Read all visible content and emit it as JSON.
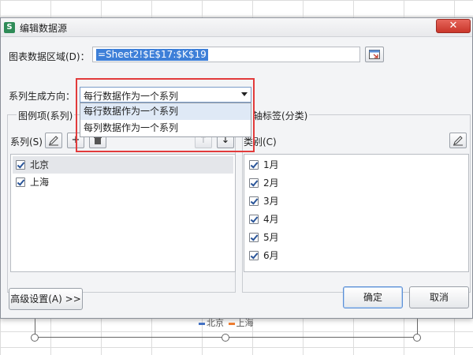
{
  "dialog": {
    "title": "编辑数据源",
    "close_label": "✕",
    "data_range_label": "图表数据区域(D)：",
    "data_range_value": "=Sheet2!$E$17:$K$19",
    "series_direction_label": "系列生成方向：",
    "series_direction_value": "每行数据作为一个系列",
    "series_direction_options": [
      "每行数据作为一个系列",
      "每列数据作为一个系列"
    ],
    "legend_group_label": "图例项(系列)",
    "series_label": "系列(S)",
    "series_items": [
      "北京",
      "上海"
    ],
    "axis_group_label": "轴标签(分类)",
    "category_label": "类别(C)",
    "category_items": [
      "1月",
      "2月",
      "3月",
      "4月",
      "5月",
      "6月"
    ],
    "advanced_label": "高级设置(A) >>",
    "ok_label": "确定",
    "cancel_label": "取消"
  },
  "chart_legend": {
    "beijing": "北京",
    "shanghai": "上海"
  },
  "colors": {
    "highlight": "#e23b3b",
    "selection": "#3d7fd8",
    "beijing": "#4472c4",
    "shanghai": "#ed7d31"
  }
}
